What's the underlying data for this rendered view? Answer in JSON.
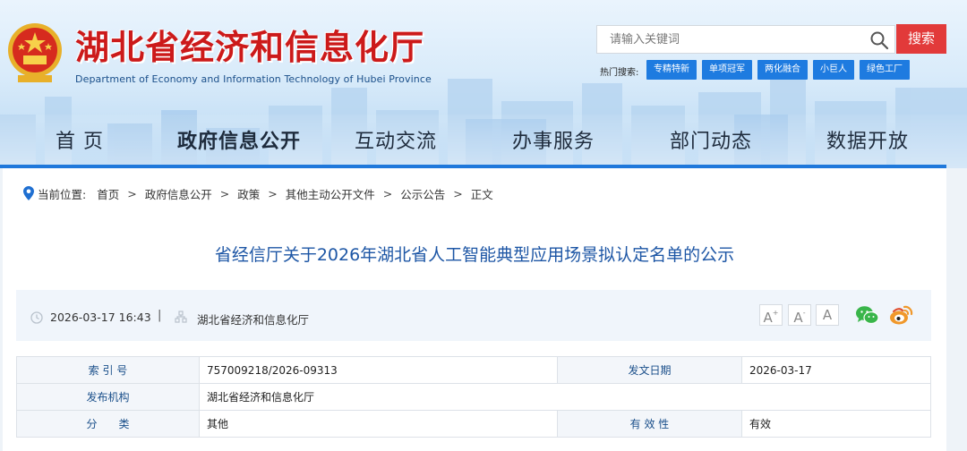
{
  "header": {
    "site_title": "湖北省经济和信息化厅",
    "site_subtitle": "Department of Economy and Information Technology of Hubei Province",
    "search": {
      "placeholder": "请输入关键词",
      "button_label": "搜索"
    },
    "hot_search": {
      "label": "热门搜索:",
      "tags": [
        "专精特新",
        "单项冠军",
        "两化融合",
        "小巨人",
        "绿色工厂"
      ]
    },
    "nav": {
      "items": [
        "首 页",
        "政府信息公开",
        "互动交流",
        "办事服务",
        "部门动态",
        "数据开放"
      ],
      "active": "政府信息公开"
    },
    "colors": {
      "title_red": "#cc1a1a",
      "nav_accent": "#1f78db",
      "search_button": "#e23a3a",
      "tag_blue": "#1e7be0"
    }
  },
  "breadcrumb": {
    "label": "当前位置:",
    "items": [
      "首页",
      "政府信息公开",
      "政策",
      "其他主动公开文件",
      "公示公告",
      "正文"
    ],
    "separator": ">"
  },
  "article": {
    "title": "省经信厅关于2026年湖北省人工智能典型应用场景拟认定名单的公示",
    "meta": {
      "datetime": "2026-03-17 16:43",
      "divider": "|",
      "source": "湖北省经济和信息化厅"
    },
    "font_sizes": {
      "increase": "A",
      "decrease": "A",
      "reset": "A",
      "increase_mark": "+",
      "decrease_mark": "-"
    },
    "share": [
      "wechat-icon",
      "weibo-icon"
    ]
  },
  "info_table": {
    "rows": [
      {
        "label1": "索 引 号",
        "value1": "757009218/2026-09313",
        "label2": "发文日期",
        "value2": "2026-03-17"
      },
      {
        "label1": "发布机构",
        "value1": "湖北省经济和信息化厅"
      },
      {
        "label1": "分　　类",
        "value1": "其他",
        "label2": "有 效 性",
        "value2": "有效"
      }
    ]
  }
}
